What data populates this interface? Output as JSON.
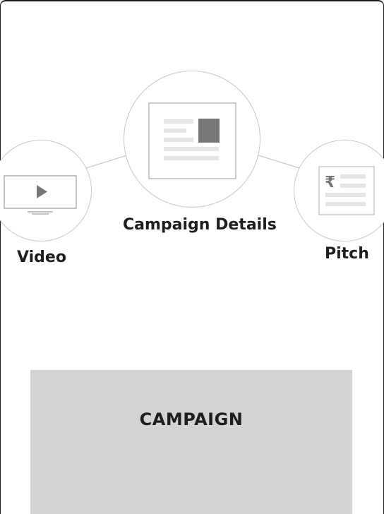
{
  "steps": {
    "video": {
      "label": "Video",
      "icon": "video-monitor-icon"
    },
    "details": {
      "label": "Campaign Details",
      "icon": "document-icon"
    },
    "pitch": {
      "label": "Pitch",
      "icon": "rupee-document-icon"
    }
  },
  "cta": {
    "label": "CAMPAIGN"
  },
  "colors": {
    "icon_gray": "#777777",
    "line_gray": "#c8c8c8",
    "cta_bg": "#d3d3d3",
    "text": "#1e1e1e"
  }
}
